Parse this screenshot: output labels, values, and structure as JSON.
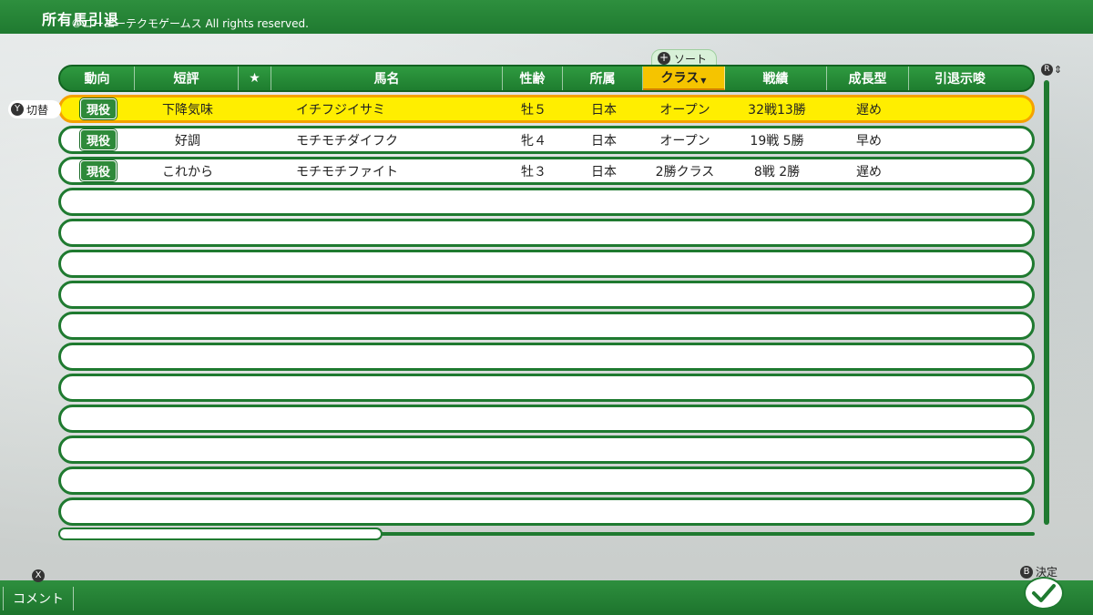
{
  "header": {
    "title": "所有馬引退",
    "copyright": "©コーエーテクモゲームス All rights reserved."
  },
  "sort": {
    "label": "ソート",
    "glyph": "+"
  },
  "swap": {
    "label": "切替",
    "glyph": "Y"
  },
  "scroll_glyph": "R",
  "columns": [
    {
      "label": "動向"
    },
    {
      "label": "短評"
    },
    {
      "label": "★"
    },
    {
      "label": "馬名"
    },
    {
      "label": "性齢"
    },
    {
      "label": "所属"
    },
    {
      "label": "クラス",
      "active": true,
      "sort_mark": "▼"
    },
    {
      "label": "戦績"
    },
    {
      "label": "成長型"
    },
    {
      "label": "引退示唆"
    }
  ],
  "rows": [
    {
      "status": "現役",
      "review": "下降気味",
      "star": "",
      "name": "イチフジイサミ",
      "sex_age": "牡５",
      "affiliation": "日本",
      "class": "オープン",
      "record": "32戦13勝",
      "growth": "遅め",
      "retire_hint": "",
      "selected": true
    },
    {
      "status": "現役",
      "review": "好調",
      "star": "",
      "name": "モチモチダイフク",
      "sex_age": "牝４",
      "affiliation": "日本",
      "class": "オープン",
      "record": "19戦 5勝",
      "growth": "早め",
      "retire_hint": "",
      "selected": false
    },
    {
      "status": "現役",
      "review": "これから",
      "star": "",
      "name": "モチモチファイト",
      "sex_age": "牡３",
      "affiliation": "日本",
      "class": "2勝クラス",
      "record": "8戦 2勝",
      "growth": "遅め",
      "retire_hint": "",
      "selected": false
    }
  ],
  "empty_rows": 11,
  "footer": {
    "comment_label": "コメント",
    "comment_glyph": "X",
    "confirm_label": "決定",
    "confirm_glyph": "B",
    "confirm_icon": "check-icon"
  },
  "colors": {
    "accent_green": "#1f7a30",
    "selected_row": "#ffee00",
    "active_header": "#f5c400"
  }
}
